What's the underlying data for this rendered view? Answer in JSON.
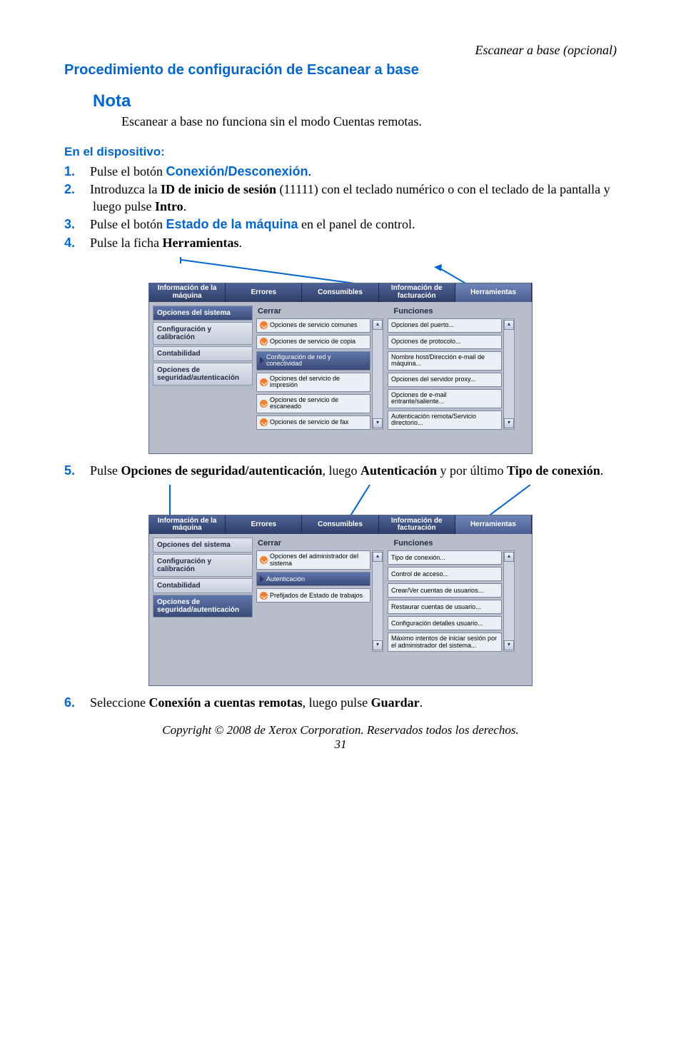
{
  "header": {
    "right": "Escanear a base (opcional)"
  },
  "h1": "Procedimiento de configuración de Escanear a base",
  "note": {
    "title": "Nota",
    "body": "Escanear a base no funciona sin el modo Cuentas remotas."
  },
  "h3": "En el dispositivo:",
  "steps": {
    "n1": "1.",
    "s1a": "Pulse el botón ",
    "s1b": "Conexión/Desconexión",
    "s1c": ".",
    "n2": "2.",
    "s2a": "Introduzca la ",
    "s2b": "ID de inicio de sesión",
    "s2c": " (11111) con el teclado numérico o con el teclado de la pantalla y luego pulse ",
    "s2d": "Intro",
    "s2e": ".",
    "n3": "3.",
    "s3a": "Pulse el botón ",
    "s3b": "Estado de la máquina",
    "s3c": " en el panel de control.",
    "n4": "4.",
    "s4a": "Pulse la ficha ",
    "s4b": "Herramientas",
    "s4c": ".",
    "n5": "5.",
    "s5a": "Pulse ",
    "s5b": "Opciones de seguridad/autenticación",
    "s5c": ", luego ",
    "s5d": "Autenticación",
    "s5e": " y por último ",
    "s5f": "Tipo de conexión",
    "s5g": ".",
    "n6": "6.",
    "s6a": "Seleccione ",
    "s6b": "Conexión a cuentas remotas",
    "s6c": ", luego pulse ",
    "s6d": "Guardar",
    "s6e": "."
  },
  "ui": {
    "tabs": {
      "t1": "Información de la máquina",
      "t2": "Errores",
      "t3": "Consumibles",
      "t4": "Información de facturación",
      "t5": "Herramientas"
    },
    "colCerrar": "Cerrar",
    "colFunciones": "Funciones",
    "scrollUp": "▴",
    "scrollDown": "▾"
  },
  "fig1": {
    "side": {
      "s1": "Opciones del sistema",
      "s2": "Configuración y calibración",
      "s3": "Contabilidad",
      "s4": "Opciones de seguridad/autenticación"
    },
    "left": {
      "l1": "Opciones de servicio comunes",
      "l2": "Opciones de servicio de copia",
      "l3": "Configuración de red y conectividad",
      "l4": "Opciones del servicio de impresión",
      "l5": "Opciones de servicio de escaneado",
      "l6": "Opciones de servicio de fax"
    },
    "right": {
      "r1": "Opciones del puerto...",
      "r2": "Opciones de protocolo...",
      "r3": "Nombre host/Dirección e-mail de máquina...",
      "r4": "Opciones del servidor proxy...",
      "r5": "Opciones de e-mail entrante/saliente...",
      "r6": "Autenticación remota/Servicio directorio..."
    }
  },
  "fig2": {
    "side": {
      "s1": "Opciones del sistema",
      "s2": "Configuración y calibración",
      "s3": "Contabilidad",
      "s4": "Opciones de seguridad/autenticación"
    },
    "left": {
      "l1": "Opciones del administrador del sistema",
      "l2": "Autenticación",
      "l3": "Prefijados de Estado de trabajos"
    },
    "right": {
      "r1": "Tipo de conexión...",
      "r2": "Control de acceso...",
      "r3": "Crear/Ver cuentas de usuarios...",
      "r4": "Restaurar cuentas de usuario...",
      "r5": "Configuración detalles usuario...",
      "r6": "Máximo intentos de iniciar sesión por el administrador del sistema..."
    }
  },
  "footer": {
    "copy": "Copyright © 2008 de Xerox Corporation. Reservados todos los derechos.",
    "page": "31"
  }
}
